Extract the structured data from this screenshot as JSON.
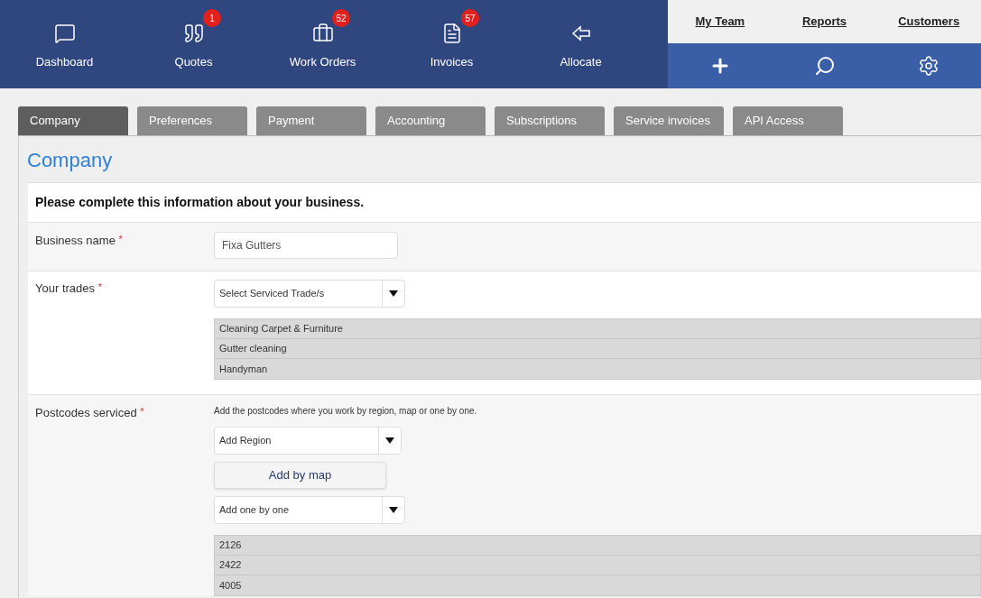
{
  "nav": [
    {
      "kind": "chat",
      "label": "Dashboard"
    },
    {
      "kind": "quote",
      "label": "Quotes",
      "badge": "1"
    },
    {
      "kind": "briefcase",
      "label": "Work Orders",
      "badge": "52"
    },
    {
      "kind": "invoice",
      "label": "Invoices",
      "badge": "57"
    },
    {
      "kind": "arrow",
      "label": "Allocate"
    }
  ],
  "top_links": [
    "My Team",
    "Reports",
    "Customers"
  ],
  "actions": [
    {
      "kind": "plus"
    },
    {
      "kind": "search"
    },
    {
      "kind": "settings"
    }
  ],
  "tabs": [
    {
      "label": "Company",
      "selected": true
    },
    {
      "label": "Preferences",
      "selected": false
    },
    {
      "label": "Payment",
      "selected": false
    },
    {
      "label": "Accounting",
      "selected": false
    },
    {
      "label": "Subscriptions",
      "selected": false
    },
    {
      "label": "Service invoices",
      "selected": false
    },
    {
      "label": "API Access",
      "selected": false
    }
  ],
  "heading": "Company",
  "intro": "Please complete this information about your business.",
  "business_name": {
    "label": "Business name",
    "marker": "*",
    "value": "Fixa Gutters"
  },
  "trades": {
    "label": "Your trades",
    "marker": "*",
    "select": "Select Serviced Trade/s",
    "items": [
      "Cleaning Carpet & Furniture",
      "Gutter cleaning",
      "Handyman"
    ]
  },
  "postcodes": {
    "label": "Postcodes serviced",
    "marker": "*",
    "hint": "Add the postcodes where you work by region, map or one by one.",
    "region_select": "Add Region",
    "map_button": "Add by map",
    "one_select": "Add one by one",
    "items": [
      "2126",
      "2422",
      "4005"
    ]
  }
}
